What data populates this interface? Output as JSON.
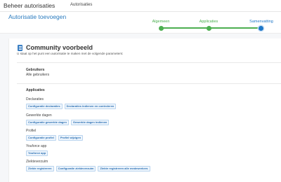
{
  "header": {
    "app_title": "Beheer autorisaties",
    "nav_link": "Autorisaties"
  },
  "page": {
    "title": "Autorisatie toevoegen"
  },
  "stepper": {
    "steps": [
      {
        "label": "Algemeen",
        "state": "done"
      },
      {
        "label": "Applicaties",
        "state": "done"
      },
      {
        "label": "Samenvatting",
        "state": "active"
      }
    ],
    "colors": {
      "done": "#4caf50",
      "active": "#1f78c8"
    }
  },
  "card": {
    "title": "Community voorbeeld",
    "subtitle": "U staat op het punt een autorisatie te maken met de volgende parameters:",
    "icon": "document-icon"
  },
  "users": {
    "heading": "Gebruikers",
    "value": "Alle gebruikers"
  },
  "applications": {
    "heading": "Applicaties",
    "groups": [
      {
        "name": "Declaraties",
        "tags": [
          "Configuratie declaraties",
          "Declaraties indienen en controleren"
        ]
      },
      {
        "name": "Gewerkte dagen",
        "tags": [
          "Configuratie gewerkte dagen",
          "Gewerkte dagen indienen"
        ]
      },
      {
        "name": "Profiel",
        "tags": [
          "Configuratie profiel",
          "Profiel wijzigen"
        ]
      },
      {
        "name": "Youforce app",
        "tags": [
          "Youforce app"
        ]
      },
      {
        "name": "Ziekteverzuim",
        "tags": [
          "Ziekte registreren",
          "Configuratie ziekteverzuim",
          "Ziekte registreren alle medewerkers"
        ]
      }
    ]
  }
}
